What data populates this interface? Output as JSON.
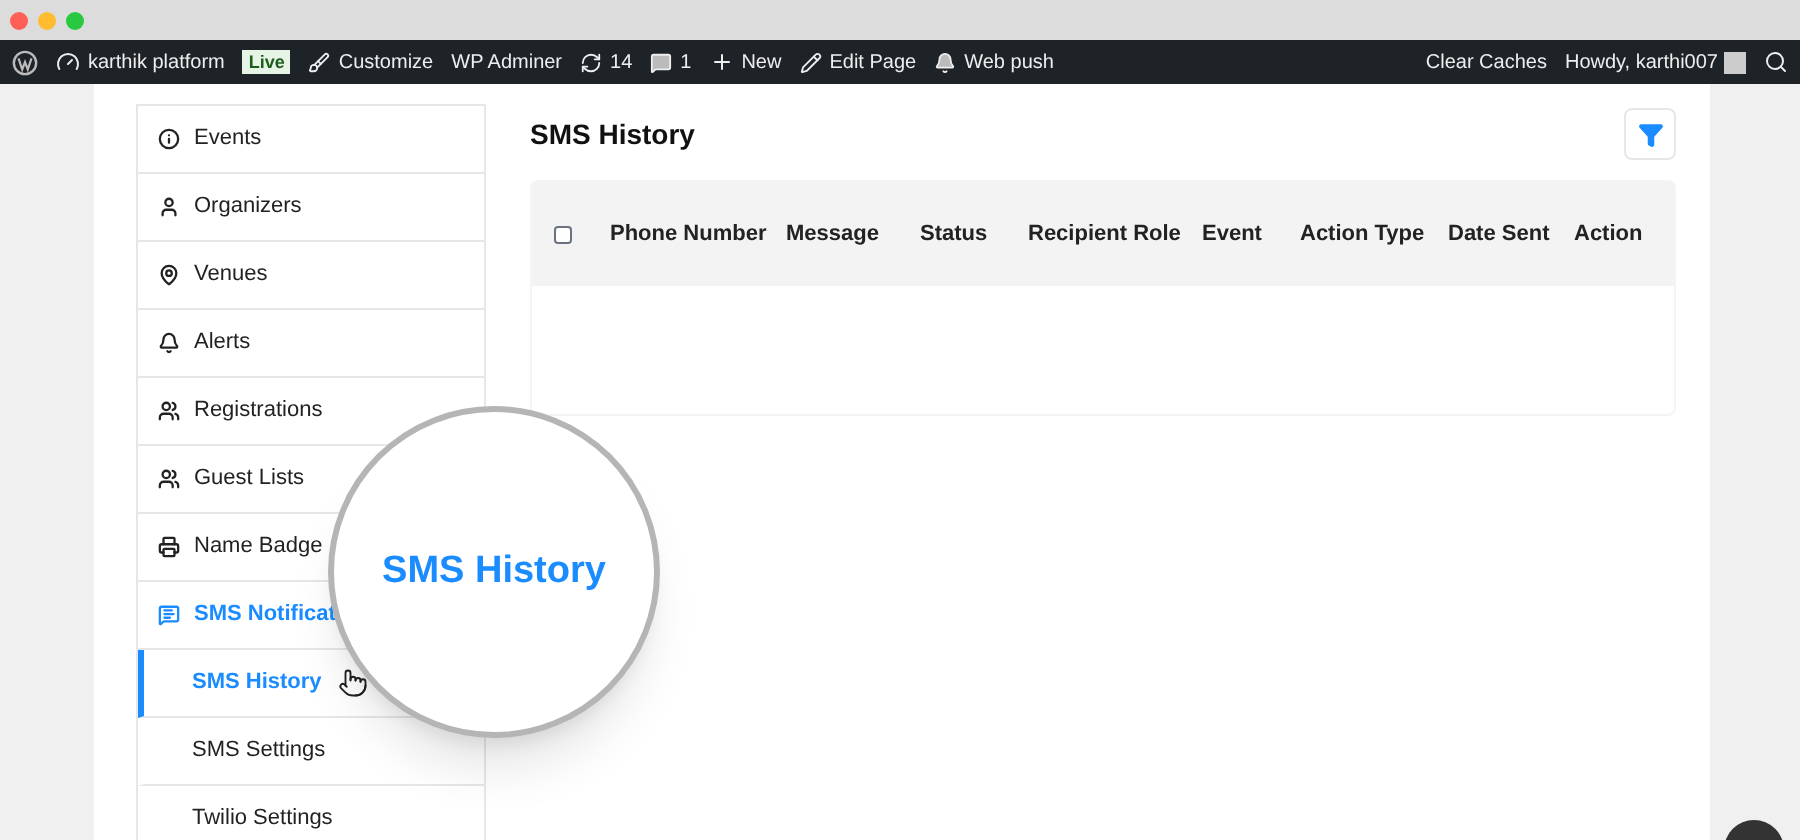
{
  "admin_bar": {
    "site": "karthik platform",
    "badge": "Live",
    "items": [
      "Customize",
      "WP Adminer"
    ],
    "updates": "14",
    "comments": "1",
    "links": [
      "New",
      "Edit Page",
      "Web push"
    ],
    "right": [
      "Clear Caches",
      "Howdy, karthi007"
    ]
  },
  "sidebar": {
    "items": [
      {
        "label": "Events",
        "selected": false
      },
      {
        "label": "Organizers",
        "selected": false
      },
      {
        "label": "Venues",
        "selected": false
      },
      {
        "label": "Alerts",
        "selected": false
      },
      {
        "label": "Registrations",
        "selected": false
      },
      {
        "label": "Guest Lists",
        "selected": false
      },
      {
        "label": "Name Badge",
        "selected": false
      },
      {
        "label": "SMS Notificat",
        "selected": true,
        "expanded": true,
        "children": [
          {
            "label": "SMS History",
            "selected": true
          },
          {
            "label": "SMS Settings",
            "selected": false
          },
          {
            "label": "Twilio Settings",
            "selected": false
          }
        ]
      }
    ]
  },
  "main": {
    "title": "SMS History",
    "table": {
      "select_all": {
        "checked": false
      },
      "columns": [
        "Phone Number",
        "Message",
        "Status",
        "Recipient Role",
        "Event",
        "Action Type",
        "Date Sent",
        "Action"
      ]
    }
  },
  "magnifier": {
    "text": "SMS History"
  }
}
